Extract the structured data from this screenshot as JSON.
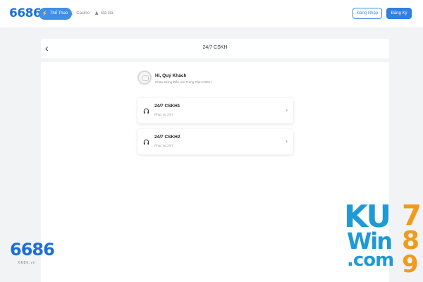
{
  "nav": {
    "logo": "6686",
    "items": [
      {
        "label": "Thể Thao",
        "icon": "lightning-icon",
        "glyph": "⚡"
      },
      {
        "label": "Casino",
        "icon": "casino-icon",
        "glyph": "♧"
      },
      {
        "label": "Đá Gà",
        "icon": "rooster-icon",
        "glyph": "♟"
      }
    ],
    "login": "Đăng Nhập",
    "register": "Đăng Ký"
  },
  "header": {
    "title": "24/7 CSKH",
    "back_glyph": "‹"
  },
  "greeting": {
    "title": "Hi, Quý Khách",
    "subtitle": "Chào Mừng Đến Với Trung Tâm CSKH"
  },
  "support": [
    {
      "name": "24/7 CSKH1",
      "sub": "Phục vụ 24/7",
      "icon": "headphones-icon"
    },
    {
      "name": "24/7 CSKH2",
      "sub": "Phục vụ 24/7",
      "icon": "headphones-icon"
    }
  ],
  "watermark": {
    "left_logo": "6686",
    "left_logo_sub": "6686.vn",
    "right_line1": "KU",
    "right_line2": "Win",
    "right_line3": ".com",
    "right_d1": "7",
    "right_d2": "8",
    "right_d3": "9"
  },
  "colors": {
    "brand": "#1d6fd8",
    "accent": "#3f8fe6",
    "ku_blue": "#1f9ad6",
    "ku_orange": "#f29a1a"
  }
}
